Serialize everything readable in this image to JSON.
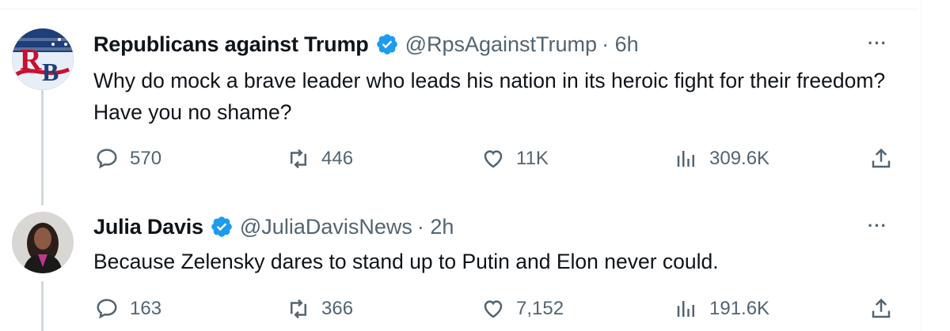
{
  "tweets": [
    {
      "name": "Republicans against Trump",
      "handle": "@RpsAgainstTrump",
      "time": "· 6h",
      "avatar_initials": "RB",
      "text": "Why do mock a brave leader who leads his nation in its heroic fight for their freedom? Have you no shame?",
      "stats": {
        "replies": "570",
        "reposts": "446",
        "likes": "11K",
        "views": "309.6K"
      }
    },
    {
      "name": "Julia Davis",
      "handle": "@JuliaDavisNews",
      "time": "· 2h",
      "text": "Because Zelensky dares to stand up to Putin and Elon never could.",
      "stats": {
        "replies": "163",
        "reposts": "366",
        "likes": "7,152",
        "views": "191.6K"
      }
    }
  ],
  "more_label": "···",
  "colors": {
    "verified": "#1d9bf0",
    "secondary_text": "#536471",
    "thread_line": "#cfd9de"
  },
  "icons": [
    "reply-icon",
    "repost-icon",
    "like-icon",
    "views-icon",
    "share-icon",
    "verified-badge-icon",
    "more-icon"
  ]
}
